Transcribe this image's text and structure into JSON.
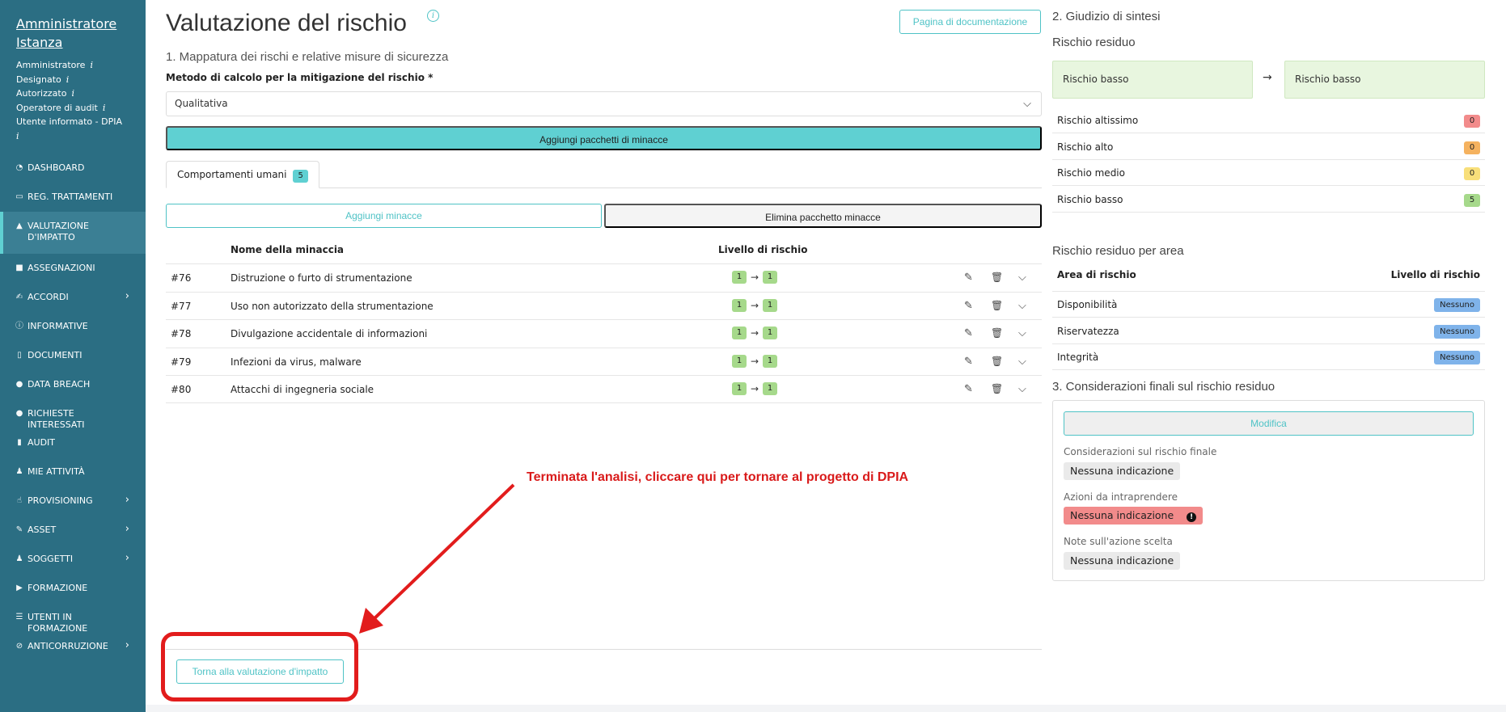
{
  "sidebar": {
    "user_name": "Amministratore Istanza",
    "roles": [
      "Amministratore",
      "Designato",
      "Autorizzato",
      "Operatore di audit",
      "Utente informato - DPIA"
    ],
    "role_info": "i",
    "items": [
      {
        "label": "DASHBOARD",
        "icon": "dashboard-icon",
        "glyph": "◔"
      },
      {
        "label": "REG. TRATTAMENTI",
        "icon": "book-icon",
        "glyph": "▭"
      },
      {
        "label": "VALUTAZIONE D'IMPATTO",
        "icon": "warning-icon",
        "glyph": "▲"
      },
      {
        "label": "ASSEGNAZIONI",
        "icon": "clipboard-icon",
        "glyph": "■"
      },
      {
        "label": "ACCORDI",
        "icon": "handshake-icon",
        "glyph": "✍"
      },
      {
        "label": "INFORMATIVE",
        "icon": "info-icon",
        "glyph": "ⓘ"
      },
      {
        "label": "DOCUMENTI",
        "icon": "file-icon",
        "glyph": "▯"
      },
      {
        "label": "DATA BREACH",
        "icon": "breach-icon",
        "glyph": "●"
      },
      {
        "label": "RICHIESTE INTERESSATI",
        "icon": "question-icon",
        "glyph": "●"
      },
      {
        "label": "AUDIT",
        "icon": "chart-icon",
        "glyph": "▮"
      },
      {
        "label": "MIE ATTIVITÀ",
        "icon": "user-icon",
        "glyph": "♟"
      },
      {
        "label": "PROVISIONING",
        "icon": "hand-icon",
        "glyph": "☝"
      },
      {
        "label": "ASSET",
        "icon": "edit-icon",
        "glyph": "✎"
      },
      {
        "label": "SOGGETTI",
        "icon": "users-icon",
        "glyph": "♟"
      },
      {
        "label": "FORMAZIONE",
        "icon": "video-icon",
        "glyph": "▶"
      },
      {
        "label": "UTENTI IN FORMAZIONE",
        "icon": "list-icon",
        "glyph": "☰"
      },
      {
        "label": "ANTICORRUZIONE",
        "icon": "ban-icon",
        "glyph": "⊘"
      }
    ],
    "chevron": "›"
  },
  "header": {
    "title": "Valutazione del rischio",
    "info": "i",
    "doc_button": "Pagina di documentazione"
  },
  "section1": {
    "title": "1. Mappatura dei rischi e relative misure di sicurezza",
    "method_label": "Metodo di calcolo per la mitigazione del rischio *",
    "method_value": "Qualitativa",
    "add_packages": "Aggiungi pacchetti di minacce",
    "tab_label": "Comportamenti umani",
    "tab_count": "5",
    "add_threats": "Aggiungi minacce",
    "delete_package": "Elimina pacchetto minacce",
    "col_name": "Nome della minaccia",
    "col_level": "Livello di rischio",
    "rows": [
      {
        "id": "#76",
        "name": "Distruzione o furto di strumentazione",
        "from": "1",
        "to": "1"
      },
      {
        "id": "#77",
        "name": "Uso non autorizzato della strumentazione",
        "from": "1",
        "to": "1"
      },
      {
        "id": "#78",
        "name": "Divulgazione accidentale di informazioni",
        "from": "1",
        "to": "1"
      },
      {
        "id": "#79",
        "name": "Infezioni da virus, malware",
        "from": "1",
        "to": "1"
      },
      {
        "id": "#80",
        "name": "Attacchi di ingegneria sociale",
        "from": "1",
        "to": "1"
      }
    ],
    "arrow": "→"
  },
  "annotation": {
    "text": "Terminata l'analisi, cliccare qui per tornare al progetto di DPIA",
    "color": "#d91a1a"
  },
  "footer": {
    "back_button": "Torna alla valutazione d'impatto"
  },
  "section2": {
    "title": "2. Giudizio di sintesi",
    "residual_title": "Rischio residuo",
    "from_box": "Rischio basso",
    "to_box": "Rischio basso",
    "arrow": "→",
    "levels": [
      {
        "label": "Rischio altissimo",
        "count": "0",
        "color": "#f28b8b"
      },
      {
        "label": "Rischio alto",
        "count": "0",
        "color": "#f5b25f"
      },
      {
        "label": "Rischio medio",
        "count": "0",
        "color": "#f8df7a"
      },
      {
        "label": "Rischio basso",
        "count": "5",
        "color": "#a6d98b"
      }
    ],
    "area_title": "Rischio residuo per area",
    "area_col": "Area di rischio",
    "level_col": "Livello di rischio",
    "areas": [
      {
        "label": "Disponibilità",
        "level": "Nessuno"
      },
      {
        "label": "Riservatezza",
        "level": "Nessuno"
      },
      {
        "label": "Integrità",
        "level": "Nessuno"
      }
    ]
  },
  "section3": {
    "title": "3. Considerazioni finali sul rischio residuo",
    "edit_button": "Modifica",
    "fields": [
      {
        "label": "Considerazioni sul rischio finale",
        "value": "Nessuna indicazione"
      },
      {
        "label": "Azioni da intraprendere",
        "value": "Nessuna indicazione"
      },
      {
        "label": "Note sull'azione scelta",
        "value": "Nessuna indicazione"
      }
    ],
    "alert_glyph": "!"
  },
  "colors": {
    "sidebar": "#2b6e83",
    "accent": "#4fc3c6",
    "accent_fill": "#5fd0d2",
    "highlight": "#e21c1c"
  }
}
